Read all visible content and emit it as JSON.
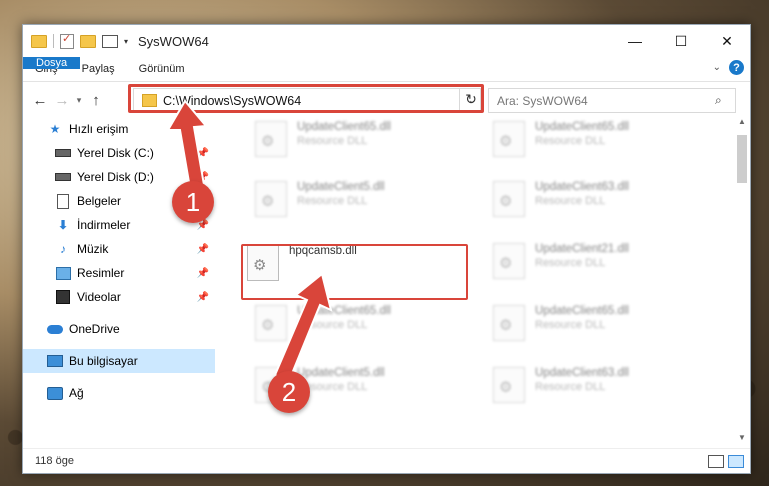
{
  "window": {
    "title": "SysWOW64"
  },
  "window_controls": {
    "minimize": "—",
    "maximize": "☐",
    "close": "✕"
  },
  "ribbon": {
    "tabs": [
      "Dosya",
      "Giriş",
      "Paylaş",
      "Görünüm"
    ],
    "help": "?"
  },
  "address": {
    "path": "C:\\Windows\\SysWOW64"
  },
  "search": {
    "placeholder": "Ara: SysWOW64"
  },
  "sidebar": {
    "items": [
      {
        "label": "Hızlı erişim"
      },
      {
        "label": "Yerel Disk (C:)"
      },
      {
        "label": "Yerel Disk (D:)"
      },
      {
        "label": "Belgeler"
      },
      {
        "label": "İndirmeler"
      },
      {
        "label": "Müzik"
      },
      {
        "label": "Resimler"
      },
      {
        "label": "Videolar"
      },
      {
        "label": "OneDrive"
      },
      {
        "label": "Bu bilgisayar"
      },
      {
        "label": "Ağ"
      }
    ]
  },
  "files": {
    "highlighted": {
      "name": "hpqcamsb.dll"
    },
    "blurred": [
      {
        "name": "UpdateClient65.dll",
        "type": "Resource DLL"
      },
      {
        "name": "UpdateClient65.dll",
        "type": "Resource DLL"
      },
      {
        "name": "UpdateClient5.dll",
        "type": "Resource DLL"
      },
      {
        "name": "UpdateClient63.dll",
        "type": "Resource DLL"
      },
      {
        "name": "UpdateClient21.dll",
        "type": "Resource DLL"
      },
      {
        "name": "UpdateClient65.dll",
        "type": "Resource DLL"
      },
      {
        "name": "UpdateClient65.dll",
        "type": "Resource DLL"
      },
      {
        "name": "UpdateClient5.dll",
        "type": "Resource DLL"
      },
      {
        "name": "UpdateClient63.dll",
        "type": "Resource DLL"
      }
    ]
  },
  "status": {
    "count": "118 öge"
  },
  "markers": {
    "one": "1",
    "two": "2"
  },
  "colors": {
    "accent": "#1979ca",
    "highlight": "#d9453a",
    "selected": "#cce8ff"
  }
}
